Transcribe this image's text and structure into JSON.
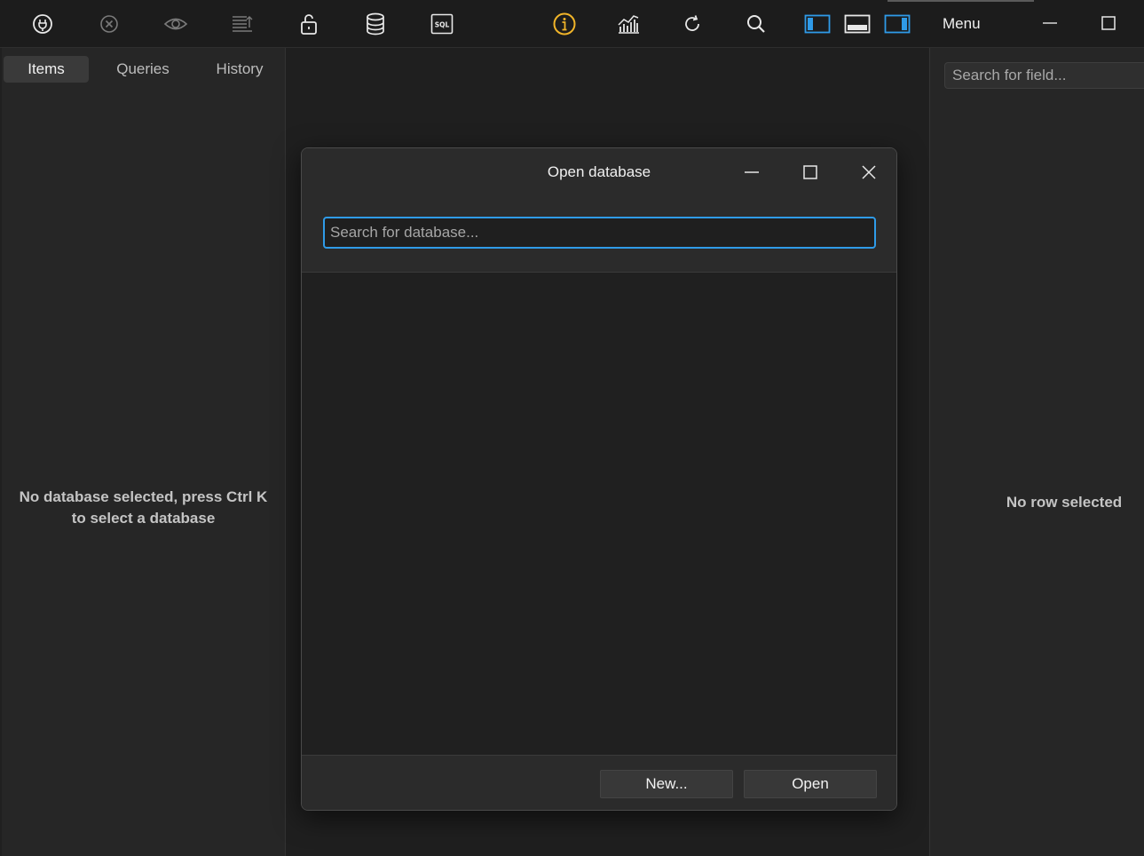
{
  "toolbar": {
    "buttons": [
      {
        "name": "connect-icon"
      },
      {
        "name": "close-circle-icon"
      },
      {
        "name": "eye-icon"
      },
      {
        "name": "sort-lines-icon"
      },
      {
        "name": "unlock-icon"
      },
      {
        "name": "database-icon"
      },
      {
        "name": "sql-icon",
        "text": "SQL"
      },
      {
        "name": "info-icon"
      },
      {
        "name": "chart-icon"
      },
      {
        "name": "refresh-icon"
      },
      {
        "name": "search-icon"
      },
      {
        "name": "layout-left-panel-icon"
      },
      {
        "name": "layout-bottom-panel-icon"
      },
      {
        "name": "layout-right-panel-icon"
      }
    ],
    "menu_label": "Menu",
    "accent_color": "#2f9be8",
    "info_color": "#f0b429"
  },
  "left_panel": {
    "tabs": [
      {
        "label": "Items",
        "active": true
      },
      {
        "label": "Queries",
        "active": false
      },
      {
        "label": "History",
        "active": false
      }
    ],
    "empty_line1": "No database selected, press Ctrl K",
    "empty_line2": "to select a database"
  },
  "right_panel": {
    "search_placeholder": "Search for field...",
    "empty_text": "No row selected"
  },
  "dialog": {
    "title": "Open database",
    "search_placeholder": "Search for database...",
    "new_button": "New...",
    "open_button": "Open"
  }
}
